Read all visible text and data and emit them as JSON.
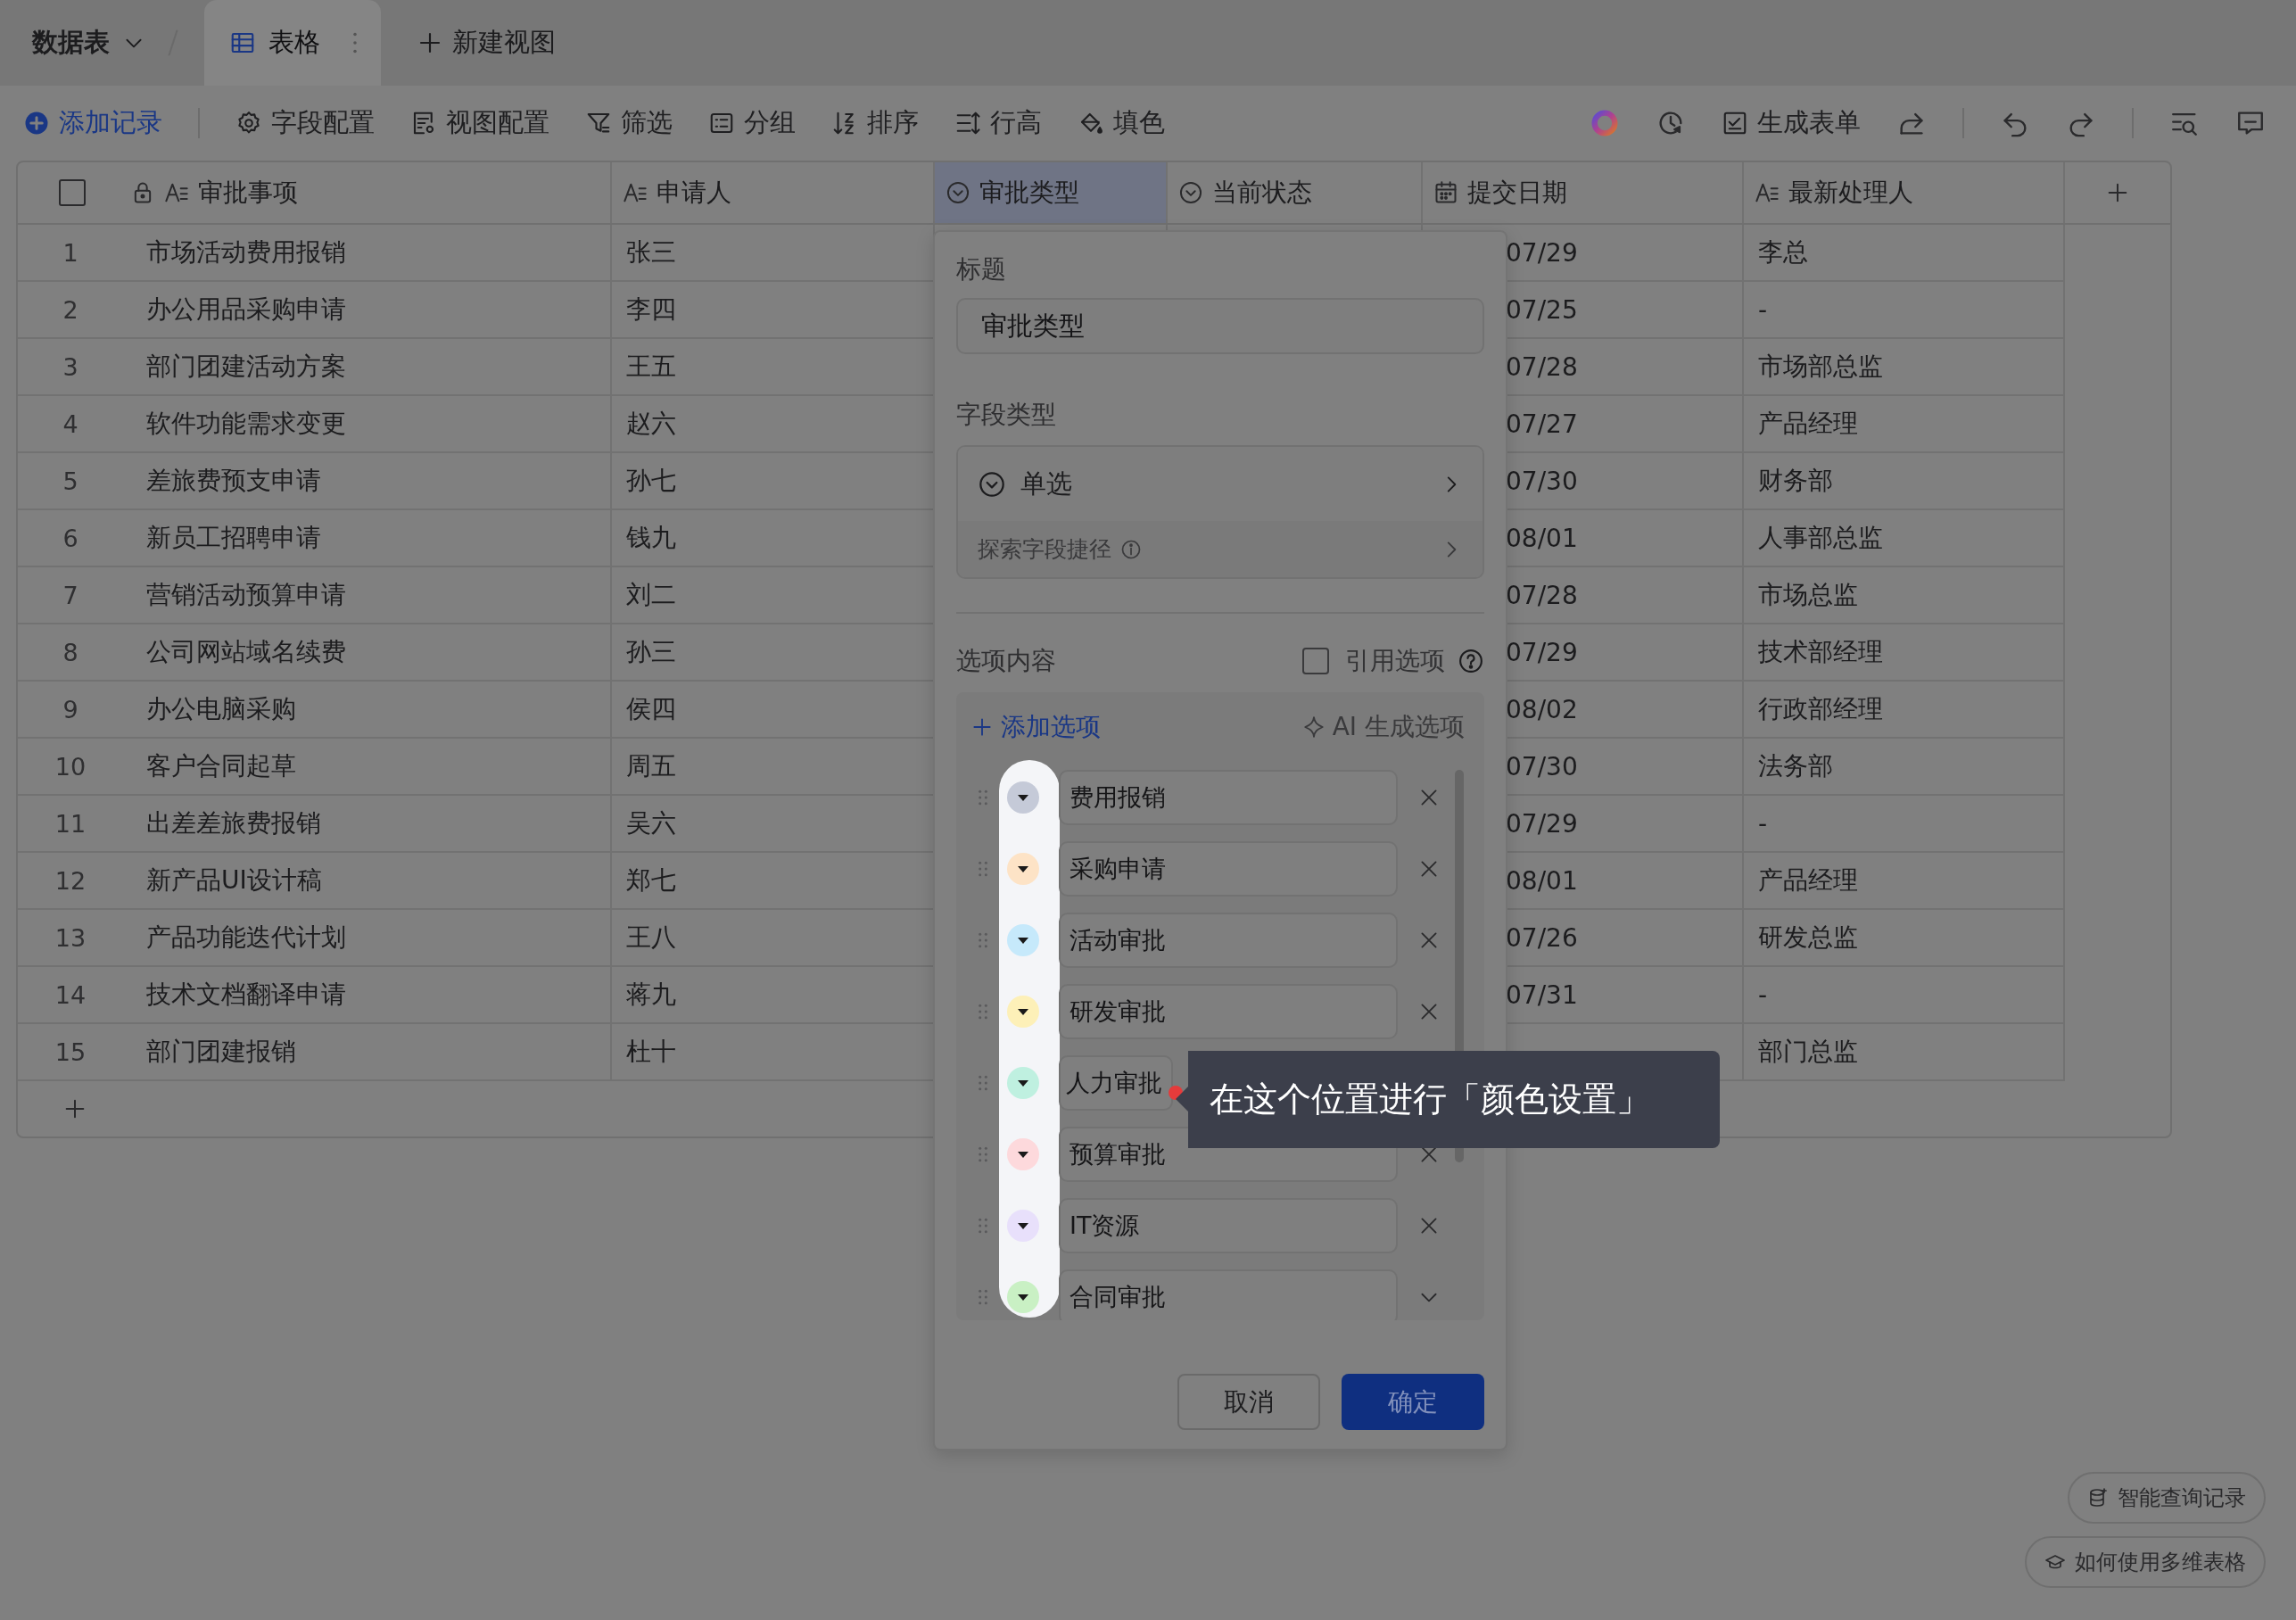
{
  "top_bar": {
    "table_menu": "数据表",
    "views": [
      {
        "label": "表格",
        "selected": true
      }
    ],
    "new_view": "新建视图"
  },
  "toolbar": {
    "left_groups": [
      [
        {
          "kind": "add",
          "label": "添加记录"
        }
      ],
      [
        {
          "kind": "gear",
          "label": "字段配置"
        },
        {
          "kind": "view",
          "label": "视图配置"
        },
        {
          "kind": "filter",
          "label": "筛选"
        },
        {
          "kind": "group",
          "label": "分组"
        },
        {
          "kind": "sort",
          "label": "排序"
        },
        {
          "kind": "height",
          "label": "行高"
        },
        {
          "kind": "fill",
          "label": "填色"
        }
      ]
    ],
    "right_groups": [
      [
        {
          "kind": "ring"
        },
        {
          "kind": "history"
        },
        {
          "kind": "form",
          "label": "生成表单"
        },
        {
          "kind": "share"
        }
      ],
      [
        {
          "kind": "undo"
        },
        {
          "kind": "redo"
        }
      ],
      [
        {
          "kind": "search"
        },
        {
          "kind": "comment"
        }
      ]
    ]
  },
  "table": {
    "columns": [
      {
        "label": "审批事项",
        "kind": "text",
        "locked": true,
        "selected": false
      },
      {
        "label": "申请人",
        "kind": "text",
        "locked": false,
        "selected": false
      },
      {
        "label": "审批类型",
        "kind": "select",
        "locked": false,
        "selected": true
      },
      {
        "label": "当前状态",
        "kind": "select",
        "locked": false,
        "selected": false
      },
      {
        "label": "提交日期",
        "kind": "date",
        "locked": false,
        "selected": false
      },
      {
        "label": "最新处理人",
        "kind": "text",
        "locked": false,
        "selected": false
      }
    ],
    "rows": [
      {
        "index": "1",
        "item": "市场活动费用报销",
        "applicant": "张三",
        "date": "07/29",
        "handler": "李总"
      },
      {
        "index": "2",
        "item": "办公用品采购申请",
        "applicant": "李四",
        "date": "07/25",
        "handler": "-"
      },
      {
        "index": "3",
        "item": "部门团建活动方案",
        "applicant": "王五",
        "date": "07/28",
        "handler": "市场部总监"
      },
      {
        "index": "4",
        "item": "软件功能需求变更",
        "applicant": "赵六",
        "date": "07/27",
        "handler": "产品经理"
      },
      {
        "index": "5",
        "item": "差旅费预支申请",
        "applicant": "孙七",
        "date": "07/30",
        "handler": "财务部"
      },
      {
        "index": "6",
        "item": "新员工招聘申请",
        "applicant": "钱九",
        "date": "08/01",
        "handler": "人事部总监"
      },
      {
        "index": "7",
        "item": "营销活动预算申请",
        "applicant": "刘二",
        "date": "07/28",
        "handler": "市场总监"
      },
      {
        "index": "8",
        "item": "公司网站域名续费",
        "applicant": "孙三",
        "date": "07/29",
        "handler": "技术部经理"
      },
      {
        "index": "9",
        "item": "办公电脑采购",
        "applicant": "侯四",
        "date": "08/02",
        "handler": "行政部经理"
      },
      {
        "index": "10",
        "item": "客户合同起草",
        "applicant": "周五",
        "date": "07/30",
        "handler": "法务部"
      },
      {
        "index": "11",
        "item": "出差差旅费报销",
        "applicant": "吴六",
        "date": "07/29",
        "handler": "-"
      },
      {
        "index": "12",
        "item": "新产品UI设计稿",
        "applicant": "郑七",
        "date": "08/01",
        "handler": "产品经理"
      },
      {
        "index": "13",
        "item": "产品功能迭代计划",
        "applicant": "王八",
        "date": "07/26",
        "handler": "研发总监"
      },
      {
        "index": "14",
        "item": "技术文档翻译申请",
        "applicant": "蒋九",
        "date": "07/31",
        "handler": "-"
      },
      {
        "index": "15",
        "item": "部门团建报销",
        "applicant": "杜十",
        "handler": "部门总监"
      }
    ]
  },
  "dialog": {
    "title_label": "标题",
    "title_value": "审批类型",
    "type_label": "字段类型",
    "type_value": "单选",
    "shortcut": "探索字段捷径",
    "options_label": "选项内容",
    "reference": {
      "label": "引用选项",
      "checked": false
    },
    "add_option": "添加选项",
    "ai_generate": "AI 生成选项",
    "options": [
      {
        "label": "费用报销",
        "color": "#c5cad8",
        "kind": "removable"
      },
      {
        "label": "采购申请",
        "color": "#fde3c6",
        "kind": "removable"
      },
      {
        "label": "活动审批",
        "color": "#c6e9fb",
        "kind": "removable"
      },
      {
        "label": "研发审批",
        "color": "#fdf0b8",
        "kind": "removable"
      },
      {
        "label": "人力审批",
        "color": "#bff0e0",
        "kind": "covered"
      },
      {
        "label": "预算审批",
        "color": "#fdd9dc",
        "kind": "removable"
      },
      {
        "label": "IT资源",
        "color": "#e8e0fb",
        "kind": "removable"
      },
      {
        "label": "合同审批",
        "color": "#c9f0c4",
        "kind": "expandable"
      }
    ],
    "cancel": "取消",
    "confirm": "确定"
  },
  "tooltip": {
    "text": "在这个位置进行「颜色设置」"
  },
  "help_buttons": [
    {
      "kind": "query",
      "label": "智能查询记录"
    },
    {
      "kind": "guide",
      "label": "如何使用多维表格"
    }
  ]
}
